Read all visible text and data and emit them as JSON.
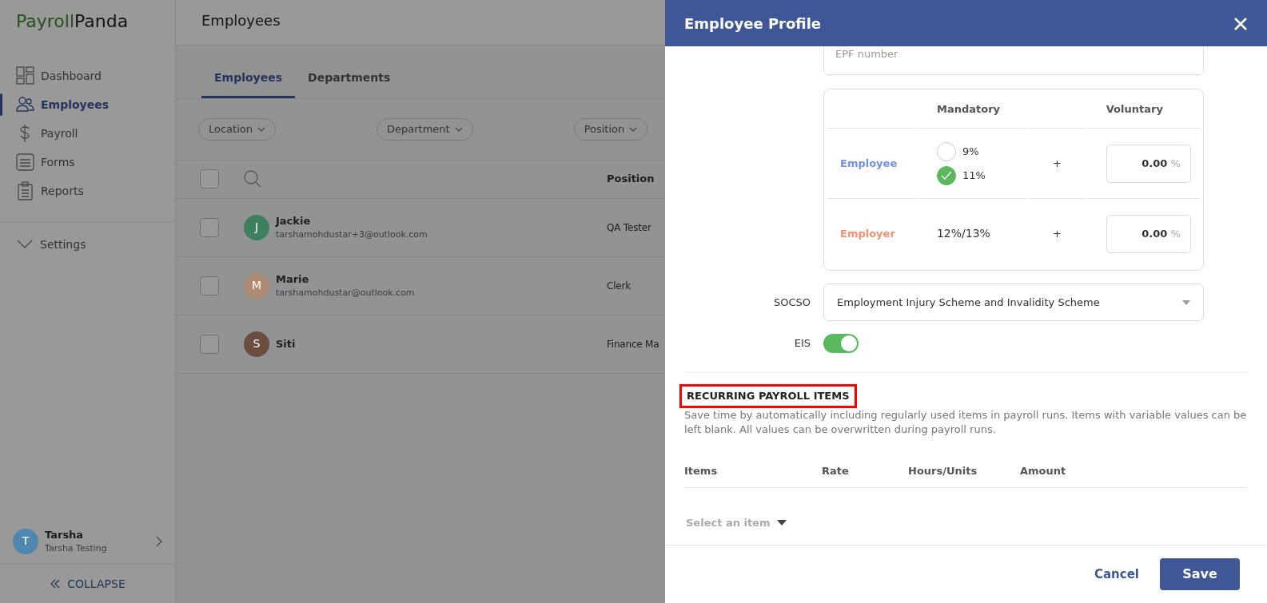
{
  "sidebar": {
    "logo": {
      "first": "Payroll",
      "second": "Panda"
    },
    "items": [
      {
        "label": "Dashboard",
        "selected": false
      },
      {
        "label": "Employees",
        "selected": true
      },
      {
        "label": "Payroll",
        "selected": false
      },
      {
        "label": "Forms",
        "selected": false
      },
      {
        "label": "Reports",
        "selected": false
      }
    ],
    "settings": {
      "label": "Settings",
      "expanded": true
    },
    "user": {
      "initial": "T",
      "name": "Tarsha",
      "subtitle": "Tarsha Testing",
      "color": "#4f87b0"
    },
    "collapse": {
      "label": "COLLAPSE"
    }
  },
  "main": {
    "title": "Employees",
    "tabs": [
      {
        "label": "Employees",
        "selected": true
      },
      {
        "label": "Departments",
        "selected": false
      }
    ],
    "filters": [
      "Location",
      "Department",
      "Position"
    ],
    "table": {
      "header_checked": false,
      "columns": [
        "Position"
      ],
      "rows": [
        {
          "initial": "J",
          "color": "#3e7f5e",
          "name": "Jackie",
          "email": "tarshamohdustar+3@outlook.com",
          "position": "QA Tester",
          "checked": false
        },
        {
          "initial": "M",
          "color": "#b08b74",
          "name": "Marie",
          "email": "tarshamohdustar@outlook.com",
          "position": "Clerk",
          "checked": false
        },
        {
          "initial": "S",
          "color": "#6b4e3e",
          "name": "Siti",
          "position": "Finance Ma",
          "checked": false
        }
      ]
    }
  },
  "drawer": {
    "title": "Employee Profile",
    "epf": {
      "placeholder": "EPF number"
    },
    "contribution": {
      "columns": [
        "Mandatory",
        "Voluntary"
      ],
      "rows": [
        {
          "label": "Employee",
          "color": "#6f8ff0",
          "kind": "options",
          "options": [
            {
              "label": "9%",
              "selected": false
            },
            {
              "label": "11%",
              "selected": true
            }
          ],
          "plus": "+",
          "voluntary": "0.00",
          "unit": "%"
        },
        {
          "label": "Employer",
          "color": "#f2916f",
          "kind": "text",
          "mandatory": "12%/13%",
          "plus": "+",
          "voluntary": "0.00",
          "unit": "%"
        }
      ]
    },
    "socso": {
      "label": "SOCSO",
      "value": "Employment Injury Scheme and Invalidity Scheme"
    },
    "eis": {
      "label": "EIS",
      "on": true
    },
    "recurring": {
      "title": "RECURRING PAYROLL ITEMS",
      "highlighted": true,
      "description": "Save time by automatically including regularly used items in payroll runs. Items with variable values can be left blank. All values can be overwritten during payroll runs.",
      "columns": [
        "Items",
        "Rate",
        "Hours/Units",
        "Amount"
      ],
      "select": "Select an item"
    },
    "buttons": {
      "cancel": "Cancel",
      "save": "Save"
    }
  }
}
